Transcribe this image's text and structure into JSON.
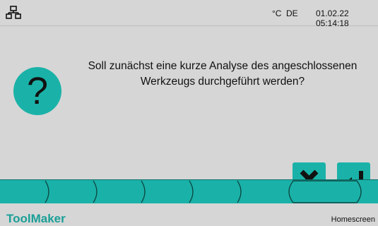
{
  "status": {
    "unit": "°C",
    "language": "DE",
    "datetime": "01.02.22 05:14:18"
  },
  "dialog": {
    "message_line1": "Soll zunächst eine kurze Analyse des angeschlossenen",
    "message_line2": "Werkzeugs durchgeführt werden?",
    "question_symbol": "?"
  },
  "footer": {
    "brand": "ToolMaker",
    "home_label": "Homescreen"
  },
  "colors": {
    "accent": "#1ab2a8",
    "brand": "#1a9f97",
    "background": "#d6d6d6"
  },
  "icons": [
    "network-icon",
    "question-icon",
    "close-icon",
    "enter-icon"
  ]
}
